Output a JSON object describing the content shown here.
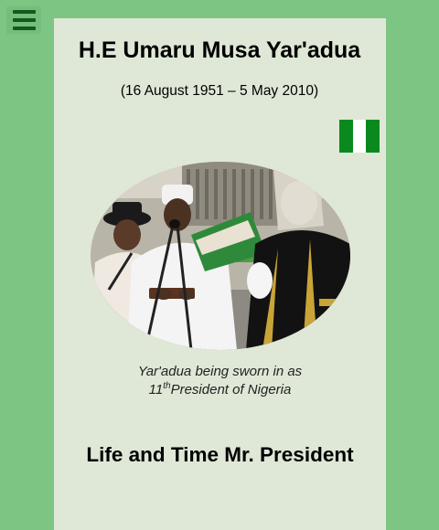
{
  "menu": {
    "icon": "hamburger-menu-icon"
  },
  "header": {
    "title": "H.E Umaru Musa Yar'adua",
    "dates": "(16 August 1951 – 5 May 2010)"
  },
  "flag": {
    "icon": "nigeria-flag-icon",
    "colors": [
      "#0a8a1e",
      "#ffffff",
      "#0a8a1e"
    ]
  },
  "photo": {
    "shape": "oval"
  },
  "caption": {
    "line1": "Yar'adua being sworn in as",
    "ordinal_number": "11",
    "ordinal_suffix": "th",
    "line2_rest": "President of Nigeria"
  },
  "section": {
    "heading": "Life and Time Mr. President"
  },
  "colors": {
    "page_background": "#7dc583",
    "card_background": "#dfe8d6",
    "menu_icon": "#0f5a1c"
  }
}
